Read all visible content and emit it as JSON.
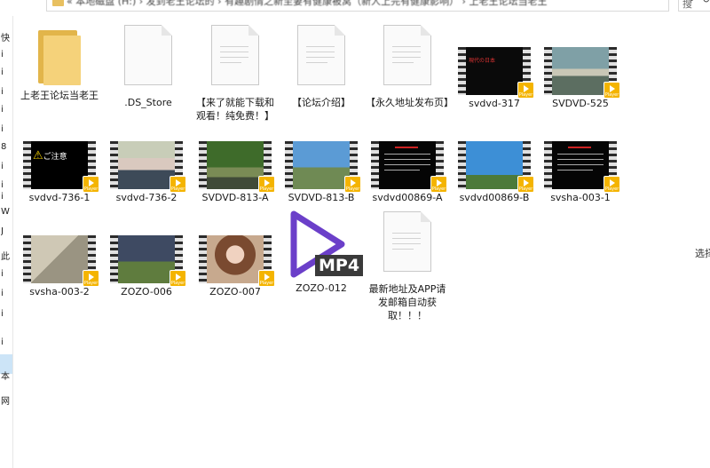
{
  "address": {
    "path": "« 本地磁盘 (H:) › 发到老王论坛的 › 有趣剧情之新至妻有健康被窝（新人上完有健康影响） › 上老王论坛当老王",
    "search_placeholder": "搜"
  },
  "nav_chars": [
    "快",
    "i",
    "i",
    "i",
    "i",
    "i",
    "8",
    "i",
    "i",
    "i",
    "W",
    "J",
    "此",
    "i",
    "i",
    "i",
    "i",
    "本",
    "网"
  ],
  "right_hint": "选择",
  "items": [
    {
      "label": "上老王论坛当老王",
      "type": "folder"
    },
    {
      "label": ".DS_Store",
      "type": "doc"
    },
    {
      "label": "【来了就能下载和观看！纯免费！】",
      "type": "doc"
    },
    {
      "label": "【论坛介绍】",
      "type": "doc"
    },
    {
      "label": "【永久地址发布页】",
      "type": "doc"
    },
    {
      "label": "svdvd-317",
      "type": "video",
      "thumb_text": "現代の日本"
    },
    {
      "label": "SVDVD-525",
      "type": "video"
    },
    {
      "label": "svdvd-736-1",
      "type": "video",
      "thumb_text": "ご注意"
    },
    {
      "label": "svdvd-736-2",
      "type": "video"
    },
    {
      "label": "SVDVD-813-A",
      "type": "video"
    },
    {
      "label": "SVDVD-813-B",
      "type": "video"
    },
    {
      "label": "svdvd00869-A",
      "type": "video"
    },
    {
      "label": "svdvd00869-B",
      "type": "video"
    },
    {
      "label": "svsha-003-1",
      "type": "video"
    },
    {
      "label": "svsha-003-2",
      "type": "video"
    },
    {
      "label": "ZOZO-006",
      "type": "video"
    },
    {
      "label": "ZOZO-007",
      "type": "video"
    },
    {
      "label": "ZOZO-012",
      "type": "mp4",
      "badge": "MP4"
    },
    {
      "label": "最新地址及APP请发邮箱自动获取！！！",
      "type": "doc"
    }
  ],
  "badge_text": "Player"
}
